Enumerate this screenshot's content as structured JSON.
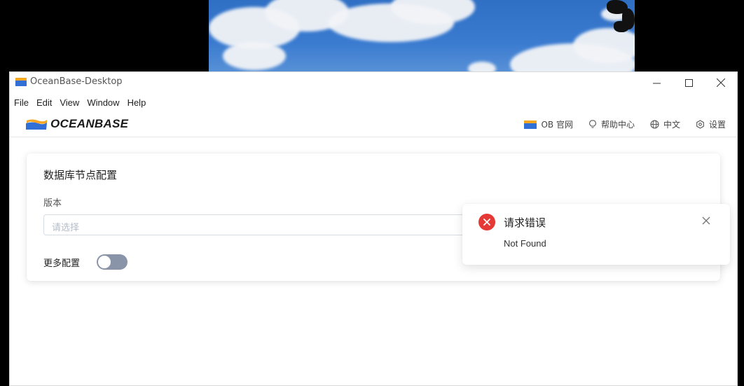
{
  "window": {
    "title": "OceanBase-Desktop"
  },
  "menu": [
    "File",
    "Edit",
    "View",
    "Window",
    "Help"
  ],
  "header": {
    "logo_text": "OCEANBASE",
    "nav": [
      {
        "icon": "ob-flag-icon",
        "label": "OB 官网"
      },
      {
        "icon": "lightbulb-icon",
        "label": "帮助中心"
      },
      {
        "icon": "globe-icon",
        "label": "中文"
      },
      {
        "icon": "gear-icon",
        "label": "设置"
      }
    ]
  },
  "config_card": {
    "title": "数据库节点配置",
    "version_label": "版本",
    "version_placeholder": "请选择",
    "more_config_label": "更多配置",
    "more_config_enabled": false
  },
  "notification": {
    "type": "error",
    "title": "请求错误",
    "message": "Not Found"
  },
  "colors": {
    "error": "#e53935",
    "switch_off": "#8a94a8",
    "placeholder": "#b5bcc8",
    "border": "#d7dbe3"
  }
}
